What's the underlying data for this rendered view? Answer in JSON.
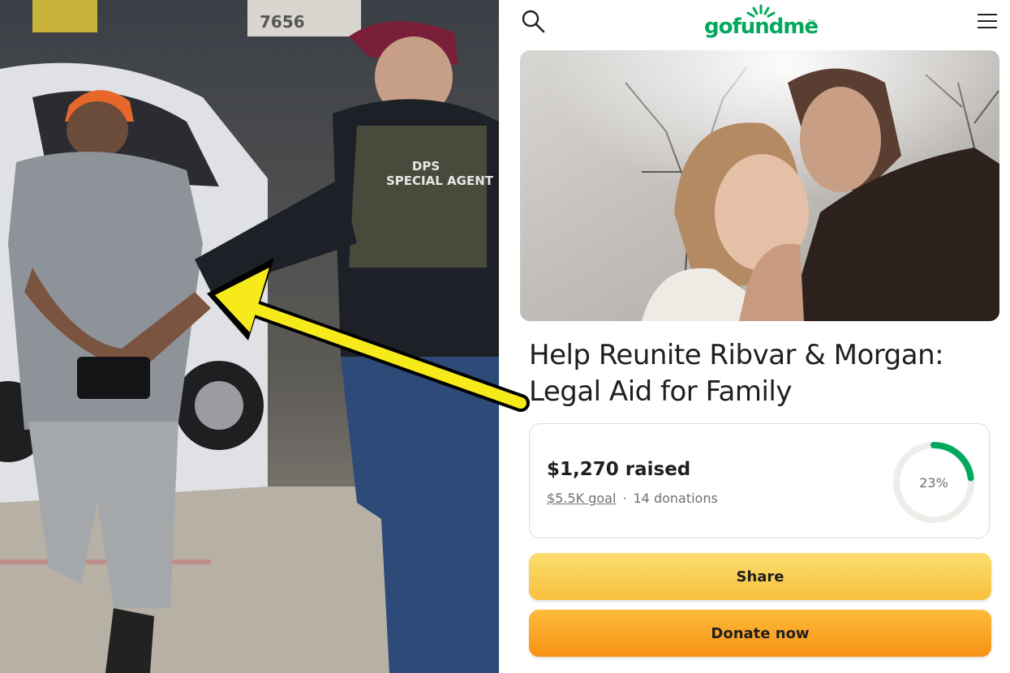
{
  "left_photo": {
    "plate_number": "7656",
    "vest_line1": "DPS",
    "vest_line2": "SPECIAL AGENT"
  },
  "header": {
    "logo_text": "gofundme",
    "logo_tm": "TM"
  },
  "campaign": {
    "title": "Help Reunite Ribvar & Morgan: Legal Aid for Family",
    "raised_text": "$1,270 raised",
    "goal_text": "$5.5K goal",
    "separator": "·",
    "donations_text": "14 donations",
    "progress_label": "23%",
    "progress_fraction": 0.23
  },
  "buttons": {
    "share_label": "Share",
    "donate_label": "Donate now"
  },
  "colors": {
    "brand_green": "#02a95c",
    "share_yellow": "#f9cf52",
    "donate_orange": "#f9a325",
    "arrow_yellow": "#f7ea1b"
  },
  "icons": {
    "search": "search-icon",
    "menu": "hamburger-menu-icon"
  }
}
